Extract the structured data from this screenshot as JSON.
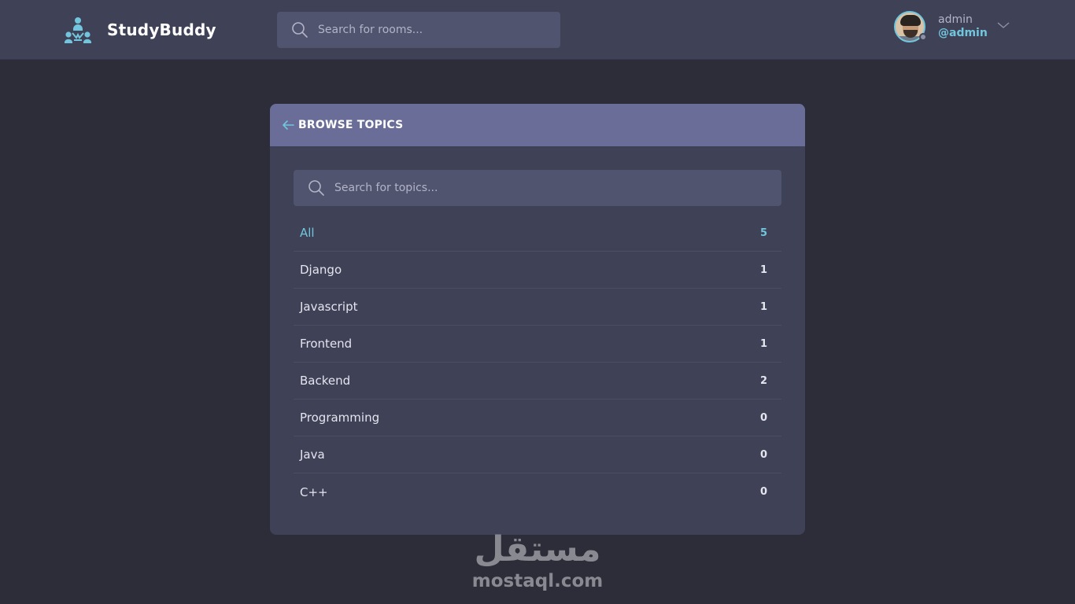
{
  "app": {
    "name": "StudyBuddy",
    "logo_icon": "team-logo-icon"
  },
  "header": {
    "search": {
      "placeholder": "Search for rooms...",
      "icon": "search-icon"
    },
    "user": {
      "name": "admin",
      "handle": "@admin",
      "avatar": "avatar",
      "status": "online-status-dot",
      "menu_icon": "chevron-down-icon"
    }
  },
  "browse": {
    "back_icon": "arrow-left-icon",
    "title": "BROWSE TOPICS",
    "search": {
      "placeholder": "Search for topics...",
      "icon": "search-icon"
    },
    "topics": [
      {
        "name": "All",
        "count": "5",
        "active": true
      },
      {
        "name": "Django",
        "count": "1"
      },
      {
        "name": "Javascript",
        "count": "1"
      },
      {
        "name": "Frontend",
        "count": "1"
      },
      {
        "name": "Backend",
        "count": "2"
      },
      {
        "name": "Programming",
        "count": "0"
      },
      {
        "name": "Java",
        "count": "0"
      },
      {
        "name": "C++",
        "count": "0"
      }
    ]
  },
  "watermark": {
    "arabic": "مستقل",
    "latin": "mostaql.com"
  },
  "colors": {
    "background": "#2d2d39",
    "header": "#3f4156",
    "card_header": "#696d97",
    "input": "#51546e",
    "accent": "#71c6dd"
  }
}
